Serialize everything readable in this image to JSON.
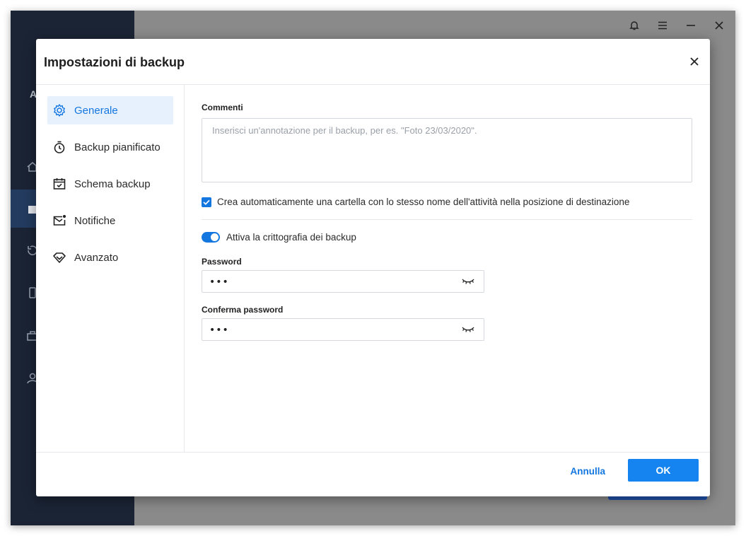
{
  "app": {
    "sidebar_logo_letter": "A",
    "titlebar_icons": [
      "bell-icon",
      "menu-icon",
      "minimize-icon",
      "close-icon"
    ]
  },
  "dialog": {
    "title": "Impostazioni di backup",
    "nav": [
      {
        "label": "Generale",
        "icon": "gear-icon",
        "active": true
      },
      {
        "label": "Backup pianificato",
        "icon": "stopwatch-icon",
        "active": false
      },
      {
        "label": "Schema backup",
        "icon": "calendar-check-icon",
        "active": false
      },
      {
        "label": "Notifiche",
        "icon": "mail-notification-icon",
        "active": false
      },
      {
        "label": "Avanzato",
        "icon": "diamond-icon",
        "active": false
      }
    ],
    "general": {
      "comments_label": "Commenti",
      "comments_placeholder": "Inserisci un'annotazione per il backup, per es. \"Foto 23/03/2020\".",
      "comments_value": "",
      "auto_folder_checkbox": {
        "label": "Crea automaticamente una cartella con lo stesso nome dell'attività nella posizione di destinazione",
        "checked": true
      },
      "encryption_toggle": {
        "label": "Attiva la crittografia dei backup",
        "on": true
      },
      "password": {
        "label": "Password",
        "value": "abc"
      },
      "confirm_password": {
        "label": "Conferma password",
        "value": "abc"
      }
    },
    "footer": {
      "cancel_label": "Annulla",
      "ok_label": "OK"
    }
  },
  "colors": {
    "accent": "#1477e0",
    "ok_button": "#1684f0",
    "app_sidebar": "#1b2435",
    "overlay": "#8a8a8a"
  }
}
